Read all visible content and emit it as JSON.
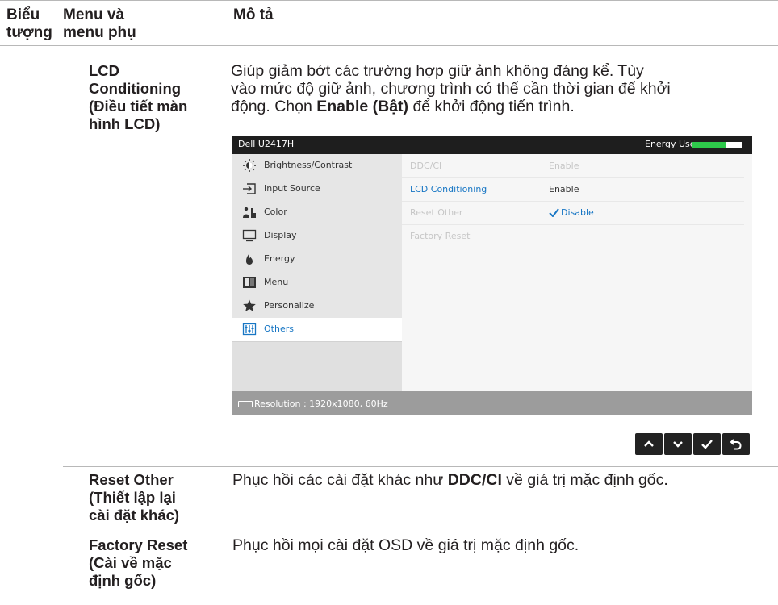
{
  "table": {
    "headers": {
      "icon_col": [
        "Biểu",
        "tượng"
      ],
      "menu_col": [
        "Menu và",
        "menu phụ"
      ],
      "desc_col": "Mô tả"
    },
    "rows": [
      {
        "name": [
          "LCD",
          "Conditioning",
          "(Điều tiết màn",
          "hình LCD)"
        ],
        "desc_lines": [
          [
            "Giúp giảm bớt các trường hợp giữ ảnh không đáng kể. Tùy",
            "",
            ""
          ],
          [
            "vào mức độ giữ ảnh, chương trình có thể cần thời gian để khởi",
            "",
            ""
          ],
          [
            "động. Chọn ",
            "Enable (Bật)",
            " để khởi động tiến trình."
          ]
        ]
      },
      {
        "name": [
          "Reset Other",
          "(Thiết lập lại",
          "cài đặt khác)"
        ],
        "desc_lines": [
          [
            "Phục hồi các cài đặt khác như ",
            "DDC/CI",
            " về giá trị mặc định gốc."
          ]
        ]
      },
      {
        "name": [
          "Factory Reset",
          "(Cài về mặc",
          "định gốc)"
        ],
        "desc_lines": [
          [
            "Phục hồi mọi cài đặt OSD về giá trị mặc định gốc.",
            "",
            ""
          ]
        ]
      }
    ]
  },
  "osd": {
    "model": "Dell U2417H",
    "energy_label": "Energy Use",
    "energy_level": 0.7,
    "energy_color": "#2ec94b",
    "accent_color": "#1776c4",
    "menu": [
      {
        "label": "Brightness/Contrast",
        "icon": "brightness-icon"
      },
      {
        "label": "Input Source",
        "icon": "input-source-icon"
      },
      {
        "label": "Color",
        "icon": "color-icon"
      },
      {
        "label": "Display",
        "icon": "display-icon"
      },
      {
        "label": "Energy",
        "icon": "energy-icon"
      },
      {
        "label": "Menu",
        "icon": "menu-icon"
      },
      {
        "label": "Personalize",
        "icon": "star-icon"
      },
      {
        "label": "Others",
        "icon": "others-icon",
        "selected": true
      }
    ],
    "submenu": [
      {
        "label": "DDC/CI",
        "value": "Enable"
      },
      {
        "label": "LCD Conditioning",
        "value": "Enable",
        "active": true
      },
      {
        "label": "Reset Other",
        "value": "Disable",
        "checked": true
      },
      {
        "label": "Factory Reset",
        "value": ""
      }
    ],
    "resolution": "Resolution : 1920x1080, 60Hz",
    "resolution_icon": "connector-icon"
  },
  "nav_buttons": [
    "up-icon",
    "down-icon",
    "check-icon",
    "back-icon"
  ]
}
